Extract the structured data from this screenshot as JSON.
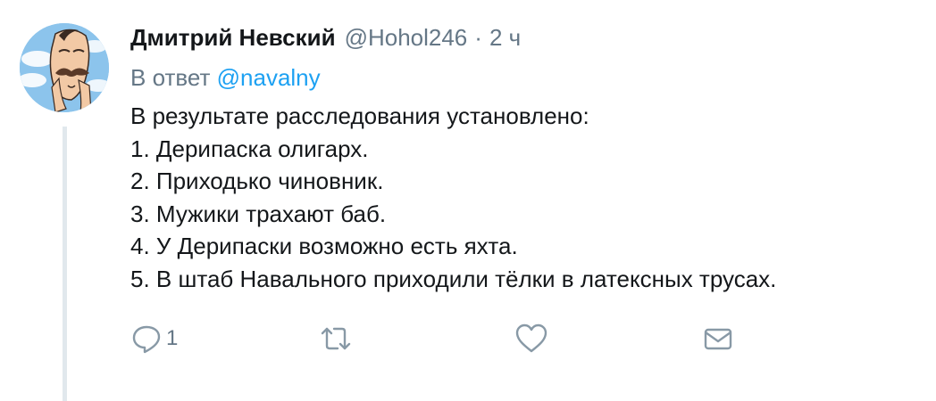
{
  "tweet": {
    "display_name": "Дмитрий Невский",
    "handle": "@Hohol246",
    "separator": "·",
    "time": "2 ч",
    "reply_prefix": "В ответ ",
    "reply_mention": "@navalny",
    "lines": [
      "В результате расследования установлено:",
      "1. Дерипаска олигарх.",
      "2. Приходько чиновник.",
      "3. Мужики трахают баб.",
      "4. У Дерипаски возможно есть яхта.",
      "5. В штаб Навального приходили тёлки в латексных трусах."
    ],
    "actions": {
      "reply_count": "1",
      "reply_icon": "reply-bubble-icon",
      "retweet_icon": "retweet-icon",
      "like_icon": "heart-icon",
      "dm_icon": "envelope-icon"
    },
    "colors": {
      "name": "#14171a",
      "secondary": "#657786",
      "link": "#1da1f2",
      "thread_line": "#e1e8ed"
    }
  }
}
